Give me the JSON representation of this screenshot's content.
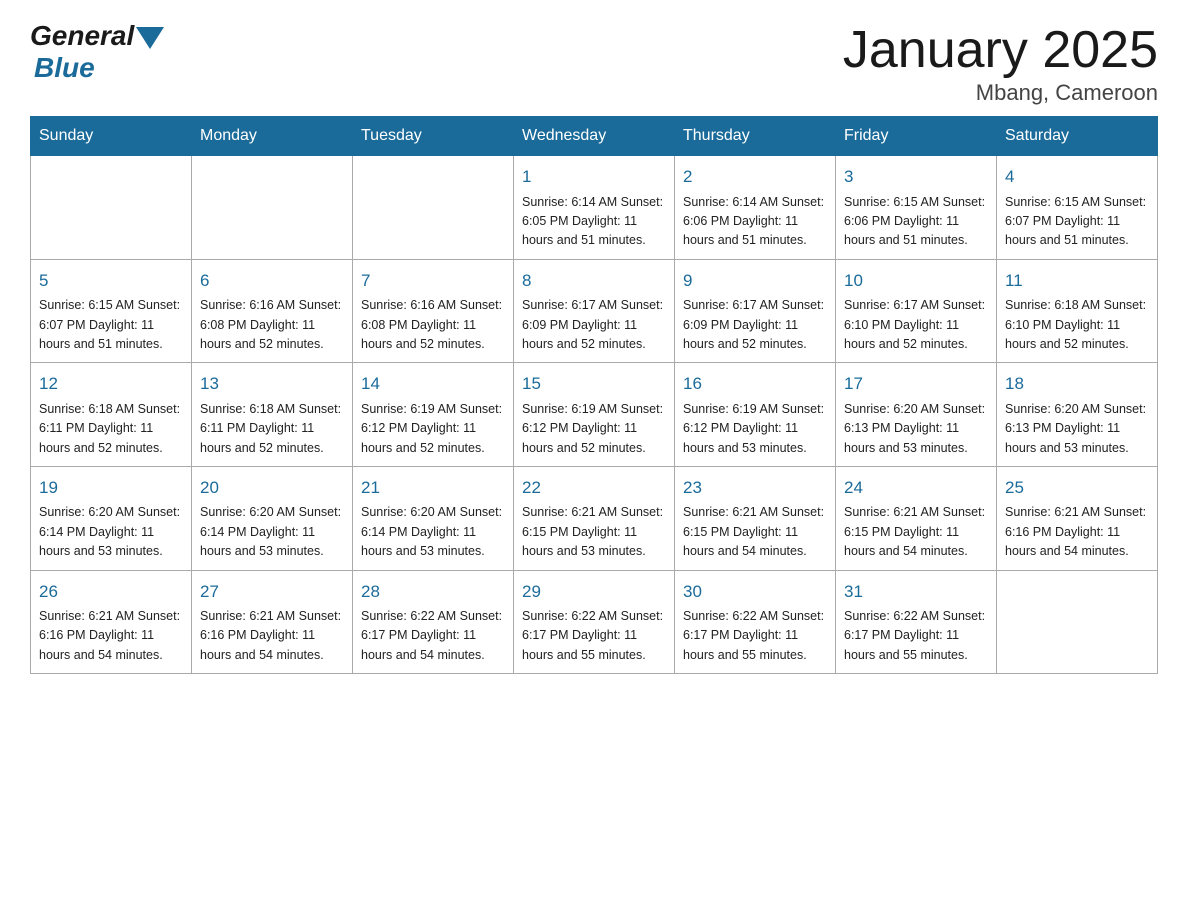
{
  "logo": {
    "general": "General",
    "blue": "Blue"
  },
  "title": "January 2025",
  "subtitle": "Mbang, Cameroon",
  "headers": [
    "Sunday",
    "Monday",
    "Tuesday",
    "Wednesday",
    "Thursday",
    "Friday",
    "Saturday"
  ],
  "weeks": [
    [
      {
        "day": "",
        "info": ""
      },
      {
        "day": "",
        "info": ""
      },
      {
        "day": "",
        "info": ""
      },
      {
        "day": "1",
        "info": "Sunrise: 6:14 AM\nSunset: 6:05 PM\nDaylight: 11 hours and 51 minutes."
      },
      {
        "day": "2",
        "info": "Sunrise: 6:14 AM\nSunset: 6:06 PM\nDaylight: 11 hours and 51 minutes."
      },
      {
        "day": "3",
        "info": "Sunrise: 6:15 AM\nSunset: 6:06 PM\nDaylight: 11 hours and 51 minutes."
      },
      {
        "day": "4",
        "info": "Sunrise: 6:15 AM\nSunset: 6:07 PM\nDaylight: 11 hours and 51 minutes."
      }
    ],
    [
      {
        "day": "5",
        "info": "Sunrise: 6:15 AM\nSunset: 6:07 PM\nDaylight: 11 hours and 51 minutes."
      },
      {
        "day": "6",
        "info": "Sunrise: 6:16 AM\nSunset: 6:08 PM\nDaylight: 11 hours and 52 minutes."
      },
      {
        "day": "7",
        "info": "Sunrise: 6:16 AM\nSunset: 6:08 PM\nDaylight: 11 hours and 52 minutes."
      },
      {
        "day": "8",
        "info": "Sunrise: 6:17 AM\nSunset: 6:09 PM\nDaylight: 11 hours and 52 minutes."
      },
      {
        "day": "9",
        "info": "Sunrise: 6:17 AM\nSunset: 6:09 PM\nDaylight: 11 hours and 52 minutes."
      },
      {
        "day": "10",
        "info": "Sunrise: 6:17 AM\nSunset: 6:10 PM\nDaylight: 11 hours and 52 minutes."
      },
      {
        "day": "11",
        "info": "Sunrise: 6:18 AM\nSunset: 6:10 PM\nDaylight: 11 hours and 52 minutes."
      }
    ],
    [
      {
        "day": "12",
        "info": "Sunrise: 6:18 AM\nSunset: 6:11 PM\nDaylight: 11 hours and 52 minutes."
      },
      {
        "day": "13",
        "info": "Sunrise: 6:18 AM\nSunset: 6:11 PM\nDaylight: 11 hours and 52 minutes."
      },
      {
        "day": "14",
        "info": "Sunrise: 6:19 AM\nSunset: 6:12 PM\nDaylight: 11 hours and 52 minutes."
      },
      {
        "day": "15",
        "info": "Sunrise: 6:19 AM\nSunset: 6:12 PM\nDaylight: 11 hours and 52 minutes."
      },
      {
        "day": "16",
        "info": "Sunrise: 6:19 AM\nSunset: 6:12 PM\nDaylight: 11 hours and 53 minutes."
      },
      {
        "day": "17",
        "info": "Sunrise: 6:20 AM\nSunset: 6:13 PM\nDaylight: 11 hours and 53 minutes."
      },
      {
        "day": "18",
        "info": "Sunrise: 6:20 AM\nSunset: 6:13 PM\nDaylight: 11 hours and 53 minutes."
      }
    ],
    [
      {
        "day": "19",
        "info": "Sunrise: 6:20 AM\nSunset: 6:14 PM\nDaylight: 11 hours and 53 minutes."
      },
      {
        "day": "20",
        "info": "Sunrise: 6:20 AM\nSunset: 6:14 PM\nDaylight: 11 hours and 53 minutes."
      },
      {
        "day": "21",
        "info": "Sunrise: 6:20 AM\nSunset: 6:14 PM\nDaylight: 11 hours and 53 minutes."
      },
      {
        "day": "22",
        "info": "Sunrise: 6:21 AM\nSunset: 6:15 PM\nDaylight: 11 hours and 53 minutes."
      },
      {
        "day": "23",
        "info": "Sunrise: 6:21 AM\nSunset: 6:15 PM\nDaylight: 11 hours and 54 minutes."
      },
      {
        "day": "24",
        "info": "Sunrise: 6:21 AM\nSunset: 6:15 PM\nDaylight: 11 hours and 54 minutes."
      },
      {
        "day": "25",
        "info": "Sunrise: 6:21 AM\nSunset: 6:16 PM\nDaylight: 11 hours and 54 minutes."
      }
    ],
    [
      {
        "day": "26",
        "info": "Sunrise: 6:21 AM\nSunset: 6:16 PM\nDaylight: 11 hours and 54 minutes."
      },
      {
        "day": "27",
        "info": "Sunrise: 6:21 AM\nSunset: 6:16 PM\nDaylight: 11 hours and 54 minutes."
      },
      {
        "day": "28",
        "info": "Sunrise: 6:22 AM\nSunset: 6:17 PM\nDaylight: 11 hours and 54 minutes."
      },
      {
        "day": "29",
        "info": "Sunrise: 6:22 AM\nSunset: 6:17 PM\nDaylight: 11 hours and 55 minutes."
      },
      {
        "day": "30",
        "info": "Sunrise: 6:22 AM\nSunset: 6:17 PM\nDaylight: 11 hours and 55 minutes."
      },
      {
        "day": "31",
        "info": "Sunrise: 6:22 AM\nSunset: 6:17 PM\nDaylight: 11 hours and 55 minutes."
      },
      {
        "day": "",
        "info": ""
      }
    ]
  ]
}
